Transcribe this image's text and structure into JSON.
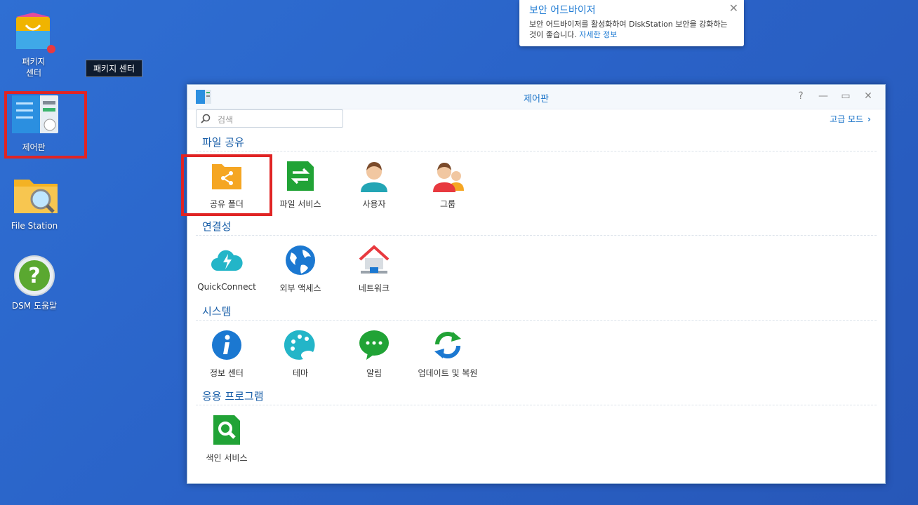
{
  "desktop": {
    "icons": [
      {
        "label_line1": "패키지",
        "label_line2": "센터"
      },
      {
        "label_line1": "제어판"
      },
      {
        "label_line1": "File Station"
      },
      {
        "label_line1": "DSM 도움말"
      }
    ],
    "tooltip": "패키지 센터"
  },
  "notification": {
    "title": "보안 어드바이저",
    "text": "보안 어드바이저를 활성화하여 DiskStation 보안을 강화하는 것이 좋습니다.",
    "link": "자세한 정보",
    "close": "✕"
  },
  "window": {
    "title": "제어판",
    "buttons": {
      "help": "?",
      "minimize": "—",
      "maximize": "▭",
      "close": "✕"
    },
    "search_placeholder": "검색",
    "advanced_mode": "고급 모드",
    "sections": [
      {
        "title": "파일 공유",
        "items": [
          "공유 폴더",
          "파일 서비스",
          "사용자",
          "그룹"
        ]
      },
      {
        "title": "연결성",
        "items": [
          "QuickConnect",
          "외부 액세스",
          "네트워크"
        ]
      },
      {
        "title": "시스템",
        "items": [
          "정보 센터",
          "테마",
          "알림",
          "업데이트 및 복원"
        ]
      },
      {
        "title": "응용 프로그램",
        "items": [
          "색인 서비스"
        ]
      }
    ]
  },
  "colors": {
    "accent": "#1a73c8",
    "highlight": "#e02424",
    "desktop": "#2a63c8"
  }
}
